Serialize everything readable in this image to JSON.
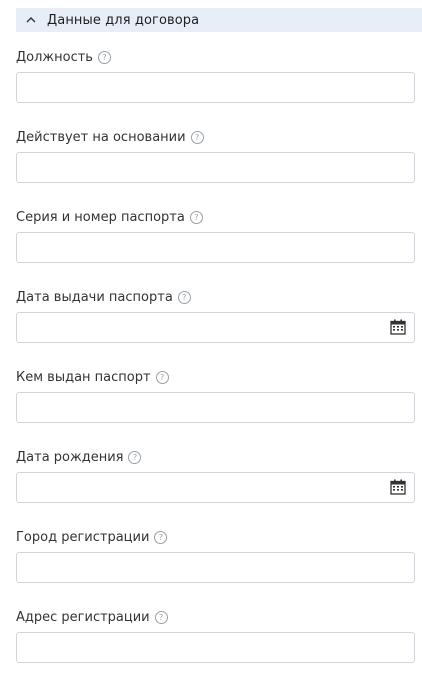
{
  "section": {
    "title": "Данные для договора",
    "expanded": true
  },
  "fields": [
    {
      "label": "Должность",
      "value": "",
      "type": "text"
    },
    {
      "label": "Действует на основании",
      "value": "",
      "type": "text"
    },
    {
      "label": "Серия и номер паспорта",
      "value": "",
      "type": "text"
    },
    {
      "label": "Дата выдачи паспорта",
      "value": "",
      "type": "date"
    },
    {
      "label": "Кем выдан паспорт",
      "value": "",
      "type": "text"
    },
    {
      "label": "Дата рождения",
      "value": "",
      "type": "date"
    },
    {
      "label": "Город регистрации",
      "value": "",
      "type": "text"
    },
    {
      "label": "Адрес регистрации",
      "value": "",
      "type": "text"
    }
  ],
  "help_glyph": "?",
  "colors": {
    "header_bg": "#e8eef8",
    "input_border": "#d2d6dc",
    "help_icon": "#9aa0a6"
  }
}
